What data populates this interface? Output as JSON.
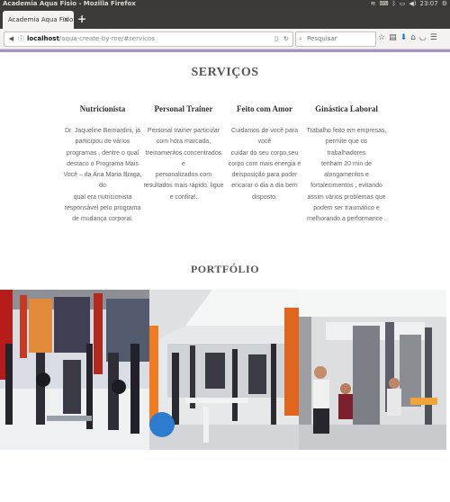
{
  "window": {
    "title": "Academia Aqua Fisio - Mozilla Firefox",
    "clock": "23:07"
  },
  "tab": {
    "label": "Academia Aqua Fisio",
    "close": "×",
    "new": "+"
  },
  "url": {
    "host": "localhost",
    "path": "/aqua-create-by-me/#servicos"
  },
  "search": {
    "placeholder": "Pesquisar"
  },
  "services": {
    "heading": "SERVIÇOS",
    "items": [
      {
        "title": "Nutricionista",
        "lines": [
          "Dr. Jaqueline Bernardini, já",
          "participou de vários",
          "programas , dentre o qual",
          "destaco o Programa Mais",
          "Você – da Ana Maria Braga, do",
          "qual era nutricionista",
          "responsável pelo programa",
          "de mudança corporal."
        ]
      },
      {
        "title": "Personal Trainer",
        "lines": [
          "Personal trainer particular",
          "com hora marcada,",
          "treinamentos concentrados e",
          "personalizados com",
          "resultados mais rápido, ligue",
          "e confira!."
        ]
      },
      {
        "title": "Feito com Amor",
        "lines": [
          "Cuidamos de você para você",
          "cuidar do seu corpo,seu",
          "corpo com mais energia e",
          "deisposição para poder",
          "encarar o dia a dia bem",
          "disposto."
        ]
      },
      {
        "title": "Ginástica Laboral",
        "lines": [
          "Trabalho feito em empresas,",
          "permite que os trabalhadores",
          "tenham 20 min de",
          "alongamentos e",
          "fortalecimentos , evitando",
          "assim vários problemas que",
          "podem ser traumático e",
          "melhorando a performance ."
        ]
      }
    ]
  },
  "portfolio": {
    "heading": "PORTFÓLIO"
  }
}
